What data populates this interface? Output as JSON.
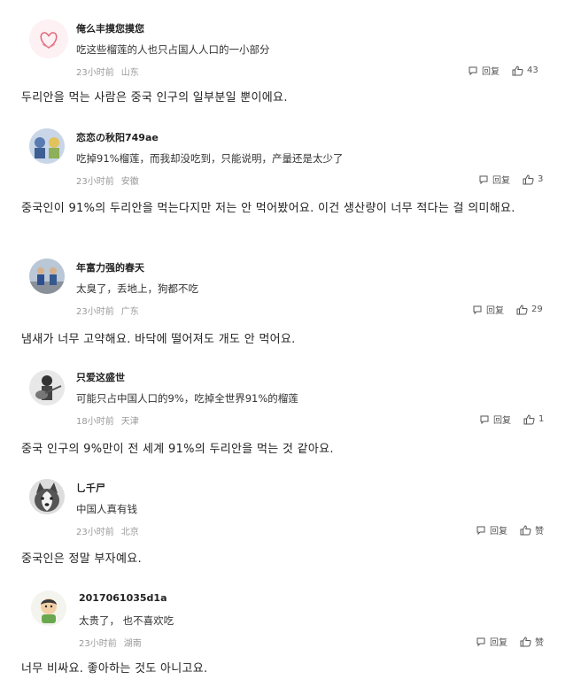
{
  "comments": [
    {
      "username": "俺么丰摸您摸您",
      "text": "吃这些榴莲的人也只占国人人口的一小部分",
      "time": "23小时前",
      "location": "山东",
      "reply": "回复",
      "likes": "43",
      "avatar": "heart-avatar"
    },
    {
      "username": "恋恋の秋阳749ae",
      "text": "吃掉91%榴莲，而我却没吃到，只能说明，产量还是太少了",
      "time": "23小时前",
      "location": "安徽",
      "reply": "回复",
      "likes": "3",
      "avatar": "figurine-avatar"
    },
    {
      "username": "年富力强的春天",
      "text": "太臭了，丢地上，狗都不吃",
      "time": "23小时前",
      "location": "广东",
      "reply": "回复",
      "likes": "29",
      "avatar": "people-avatar"
    },
    {
      "username": "只爱这盛世",
      "text": "可能只占中国人口的9%，吃掉全世界91%的榴莲",
      "time": "18小时前",
      "location": "天津",
      "reply": "回复",
      "likes": "1",
      "avatar": "guitarist-avatar"
    },
    {
      "username": "乚千尸",
      "text": "中国人真有钱",
      "time": "23小时前",
      "location": "北京",
      "reply": "回复",
      "likes": "赞",
      "avatar": "husky-avatar"
    },
    {
      "username": "2017061035d1a",
      "text": "太贵了，  也不喜欢吃",
      "time": "23小时前",
      "location": "湖南",
      "reply": "回复",
      "likes": "赞",
      "avatar": "cartoon-avatar"
    }
  ],
  "translations": [
    "두리안을 먹는 사람은 중국 인구의 일부분일 뿐이에요.",
    "중국인이 91%의 두리안을 먹는다지만 저는 안 먹어봤어요. 이건 생산량이 너무 적다는 걸 의미해요.",
    "냄새가 너무 고약해요. 바닥에 떨어져도 개도 안 먹어요.",
    "중국 인구의 9%만이 전 세계 91%의 두리안을 먹는 것 같아요.",
    "중국인은 정말 부자예요.",
    "너무 비싸요. 좋아하는 것도 아니고요."
  ]
}
